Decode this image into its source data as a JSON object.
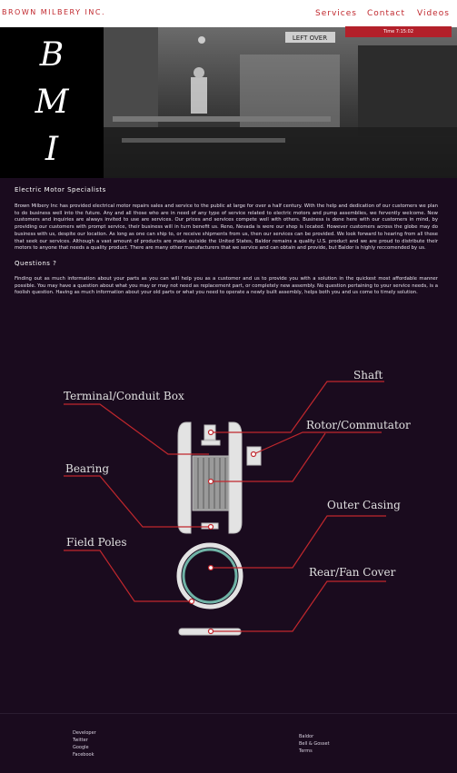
{
  "header": {
    "brand": "BROWN MILBERY INC.",
    "nav": [
      "Services",
      "Contact",
      "Videos"
    ],
    "time_label": "Time 7:15:02"
  },
  "hero": {
    "monogram": [
      "B",
      "M",
      "I"
    ],
    "photo_sign": "LEFT OVER"
  },
  "main": {
    "heading1": "Electric Motor Specialists",
    "paragraph1": "Brown Milbery Inc has provided electrical motor repairs sales and service to the public at large for over a half century. With the help and dedication of our customers we plan to do business well into the future. Any and all those who are in need of any type of service related to electric motors and pump assemblies, we fervently welcome. New customers and inquiries are always invited to use are services. Our prices and services compete well with others. Business is done here with our customers in mind, by providing our customers with prompt service, their business will in turn benefit us. Reno, Nevada is were our shop is located. However customers across the globe may do business with us, despite our location. As long as one can ship to, or receive shipments from us, then our services can be provided. We look forward to hearing from all those that seek our services. Although a vast amount of products are made outside the United States, Baldor remains a quality U.S. product and we are proud to distribute their motors to anyone that needs a quality product. There are many other manufacturers that we service and can obtain and provide, but Baldor is highly reccomended by us.",
    "heading2": "Questions ?",
    "paragraph2": "Finding out as much information about your parts as you can will help you as a customer and us to provide you with a solution in the quickest most affordable manner possible. You may have a question about what you may or may not need as replacement part, or completely new assembly. No question pertaining to your service needs, is a foolish question. Having as much information about your old parts or what you need to operate a newly built assembly, helps both you and us come to timely solution."
  },
  "diagram": {
    "labels": {
      "shaft": "Shaft",
      "terminal": "Terminal/Conduit Box",
      "rotor": "Rotor/Commutator",
      "bearing": "Bearing",
      "outer": "Outer Casing",
      "field": "Field Poles",
      "rear": "Rear/Fan Cover"
    },
    "accent": "#c0272d",
    "part_color": "#e3e3e3",
    "ring_color": "#6fb3a6"
  },
  "footer": {
    "left_links": [
      "Developer",
      "Twitter",
      "Google",
      "Facebook"
    ],
    "right_links": [
      "Baldor",
      "Bell & Gosset",
      "Terms"
    ]
  }
}
